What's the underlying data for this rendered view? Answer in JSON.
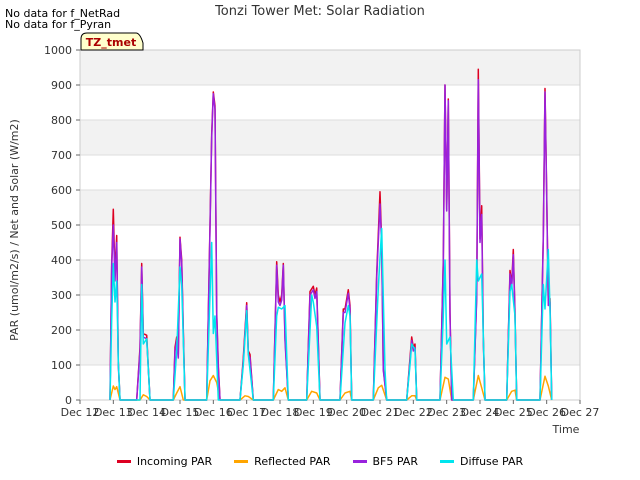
{
  "notes": [
    "No data for f_NetRad",
    "No data for f_Pyran"
  ],
  "chart_data": {
    "type": "line",
    "title": "Tonzi Tower Met: Solar Radiation",
    "xlabel": "Time",
    "ylabel": "PAR (umol/m2/s) / Net and Solar (W/m2)",
    "ylim": [
      0,
      1000
    ],
    "yticks": [
      0,
      100,
      200,
      300,
      400,
      500,
      600,
      700,
      800,
      900,
      1000
    ],
    "xlim": [
      12,
      27
    ],
    "xticks": [
      12,
      13,
      14,
      15,
      16,
      17,
      18,
      19,
      20,
      21,
      22,
      23,
      24,
      25,
      26,
      27
    ],
    "xtick_labels": [
      "Dec 12",
      "Dec 13",
      "Dec 14",
      "Dec 15",
      "Dec 16",
      "Dec 17",
      "Dec 18",
      "Dec 19",
      "Dec 20",
      "Dec 21",
      "Dec 22",
      "Dec 23",
      "Dec 24",
      "Dec 25",
      "Dec 26",
      "Dec 27"
    ],
    "annotation": "TZ_tmet",
    "grid": "horizontal bands",
    "legend_position": "bottom",
    "series": [
      {
        "name": "Incoming PAR",
        "color": "#dd0022",
        "x": [
          12.9,
          12.95,
          13.0,
          13.05,
          13.1,
          13.12,
          13.15,
          13.2,
          13.3,
          13.7,
          13.8,
          13.85,
          13.9,
          14.0,
          14.1,
          14.8,
          14.85,
          14.9,
          14.95,
          15.0,
          15.05,
          15.1,
          15.15,
          15.8,
          15.9,
          15.95,
          16.0,
          16.05,
          16.1,
          16.15,
          16.2,
          16.8,
          16.9,
          17.0,
          17.05,
          17.1,
          17.2,
          17.8,
          17.9,
          17.95,
          18.0,
          18.05,
          18.1,
          18.15,
          18.25,
          18.8,
          18.9,
          19.0,
          19.05,
          19.1,
          19.2,
          19.8,
          19.9,
          19.95,
          20.05,
          20.1,
          20.15,
          20.8,
          20.9,
          21.0,
          21.05,
          21.1,
          21.2,
          21.8,
          21.9,
          21.95,
          22.0,
          22.05,
          22.1,
          22.8,
          22.9,
          22.95,
          23.0,
          23.05,
          23.1,
          23.15,
          23.8,
          23.9,
          23.95,
          24.0,
          24.05,
          24.1,
          24.15,
          24.8,
          24.9,
          24.95,
          25.0,
          25.05,
          25.1,
          25.8,
          25.9,
          25.95,
          26.0,
          26.05,
          26.1,
          26.15
        ],
        "y": [
          0,
          390,
          545,
          360,
          470,
          330,
          110,
          0,
          0,
          0,
          150,
          390,
          190,
          185,
          0,
          0,
          150,
          180,
          130,
          465,
          400,
          200,
          0,
          0,
          500,
          760,
          880,
          840,
          250,
          100,
          0,
          0,
          120,
          278,
          140,
          130,
          0,
          0,
          395,
          300,
          280,
          300,
          390,
          180,
          0,
          0,
          310,
          325,
          300,
          320,
          0,
          0,
          260,
          260,
          315,
          270,
          0,
          0,
          360,
          595,
          450,
          90,
          0,
          0,
          120,
          180,
          150,
          160,
          0,
          0,
          400,
          900,
          545,
          860,
          250,
          0,
          0,
          300,
          945,
          460,
          555,
          180,
          0,
          0,
          370,
          330,
          430,
          250,
          0,
          0,
          470,
          890,
          590,
          280,
          290,
          0
        ]
      },
      {
        "name": "Reflected PAR",
        "color": "#ffa500",
        "x": [
          12.9,
          13.0,
          13.05,
          13.1,
          13.2,
          13.8,
          13.9,
          14.0,
          14.1,
          14.8,
          14.9,
          15.0,
          15.1,
          15.8,
          15.9,
          16.0,
          16.1,
          16.2,
          16.8,
          16.95,
          17.05,
          17.2,
          17.8,
          17.95,
          18.05,
          18.15,
          18.25,
          18.8,
          18.95,
          19.1,
          19.2,
          19.8,
          19.95,
          20.1,
          20.15,
          20.8,
          20.95,
          21.05,
          21.2,
          21.8,
          21.95,
          22.05,
          22.1,
          22.8,
          22.95,
          23.05,
          23.15,
          23.8,
          23.95,
          24.05,
          24.15,
          24.8,
          24.95,
          25.05,
          25.1,
          25.8,
          25.95,
          26.05,
          26.15
        ],
        "y": [
          0,
          40,
          30,
          38,
          0,
          0,
          15,
          10,
          0,
          0,
          20,
          38,
          0,
          0,
          55,
          70,
          50,
          0,
          0,
          12,
          10,
          0,
          0,
          30,
          25,
          35,
          0,
          0,
          25,
          20,
          0,
          0,
          20,
          25,
          0,
          0,
          35,
          42,
          0,
          0,
          12,
          12,
          0,
          0,
          65,
          60,
          0,
          0,
          70,
          35,
          0,
          0,
          25,
          28,
          0,
          0,
          68,
          40,
          0
        ]
      },
      {
        "name": "BF5 PAR",
        "color": "#9922dd",
        "x": [
          12.9,
          12.95,
          13.0,
          13.05,
          13.1,
          13.12,
          13.15,
          13.2,
          13.3,
          13.7,
          13.8,
          13.85,
          13.9,
          14.0,
          14.1,
          14.8,
          14.85,
          14.9,
          14.95,
          15.0,
          15.05,
          15.1,
          15.15,
          15.8,
          15.9,
          15.95,
          16.0,
          16.05,
          16.1,
          16.15,
          16.2,
          16.8,
          16.9,
          17.0,
          17.05,
          17.1,
          17.2,
          17.8,
          17.9,
          17.95,
          18.0,
          18.05,
          18.1,
          18.15,
          18.25,
          18.8,
          18.9,
          19.0,
          19.05,
          19.1,
          19.2,
          19.8,
          19.9,
          19.95,
          20.05,
          20.1,
          20.15,
          20.8,
          20.9,
          21.0,
          21.05,
          21.1,
          21.2,
          21.8,
          21.9,
          21.95,
          22.0,
          22.05,
          22.1,
          22.8,
          22.9,
          22.95,
          23.0,
          23.05,
          23.1,
          23.15,
          23.8,
          23.9,
          23.95,
          24.0,
          24.05,
          24.1,
          24.15,
          24.8,
          24.9,
          24.95,
          25.0,
          25.05,
          25.1,
          25.8,
          25.9,
          25.95,
          26.0,
          26.05,
          26.1,
          26.15
        ],
        "y": [
          0,
          380,
          500,
          340,
          450,
          320,
          100,
          0,
          0,
          0,
          140,
          380,
          180,
          175,
          0,
          0,
          140,
          170,
          120,
          460,
          390,
          190,
          0,
          0,
          490,
          750,
          875,
          830,
          240,
          90,
          0,
          0,
          110,
          270,
          130,
          120,
          0,
          0,
          385,
          280,
          270,
          285,
          385,
          170,
          0,
          0,
          300,
          315,
          290,
          310,
          0,
          0,
          250,
          250,
          305,
          260,
          0,
          0,
          350,
          560,
          440,
          85,
          0,
          0,
          110,
          170,
          140,
          150,
          0,
          0,
          390,
          900,
          540,
          855,
          240,
          0,
          0,
          290,
          915,
          450,
          530,
          170,
          0,
          0,
          360,
          320,
          415,
          240,
          0,
          0,
          460,
          880,
          580,
          270,
          280,
          0
        ]
      },
      {
        "name": "Diffuse PAR",
        "color": "#00e5ee",
        "x": [
          12.9,
          12.95,
          13.0,
          13.05,
          13.1,
          13.15,
          13.2,
          13.8,
          13.85,
          13.9,
          14.0,
          14.1,
          14.8,
          14.9,
          15.0,
          15.05,
          15.15,
          15.8,
          15.9,
          15.95,
          16.0,
          16.05,
          16.15,
          16.8,
          16.9,
          17.0,
          17.05,
          17.2,
          17.8,
          17.9,
          17.95,
          18.05,
          18.15,
          18.25,
          18.8,
          18.95,
          19.0,
          19.1,
          19.2,
          19.8,
          19.95,
          20.05,
          20.1,
          20.15,
          20.8,
          20.95,
          21.05,
          21.15,
          21.2,
          21.8,
          21.9,
          21.95,
          22.05,
          22.1,
          22.8,
          22.9,
          22.95,
          23.0,
          23.1,
          23.2,
          23.8,
          23.9,
          23.95,
          24.05,
          24.15,
          24.8,
          24.9,
          24.95,
          25.05,
          25.1,
          25.8,
          25.9,
          25.95,
          26.05,
          26.1,
          26.15
        ],
        "y": [
          0,
          230,
          390,
          280,
          340,
          110,
          0,
          0,
          330,
          160,
          175,
          0,
          0,
          140,
          380,
          330,
          0,
          0,
          300,
          450,
          190,
          240,
          0,
          0,
          100,
          255,
          130,
          0,
          0,
          240,
          265,
          260,
          270,
          0,
          0,
          300,
          280,
          210,
          0,
          0,
          220,
          270,
          240,
          0,
          0,
          320,
          490,
          85,
          0,
          0,
          100,
          160,
          145,
          0,
          0,
          240,
          400,
          160,
          180,
          0,
          0,
          400,
          340,
          360,
          0,
          0,
          310,
          330,
          240,
          0,
          0,
          330,
          260,
          430,
          260,
          0
        ]
      }
    ]
  }
}
